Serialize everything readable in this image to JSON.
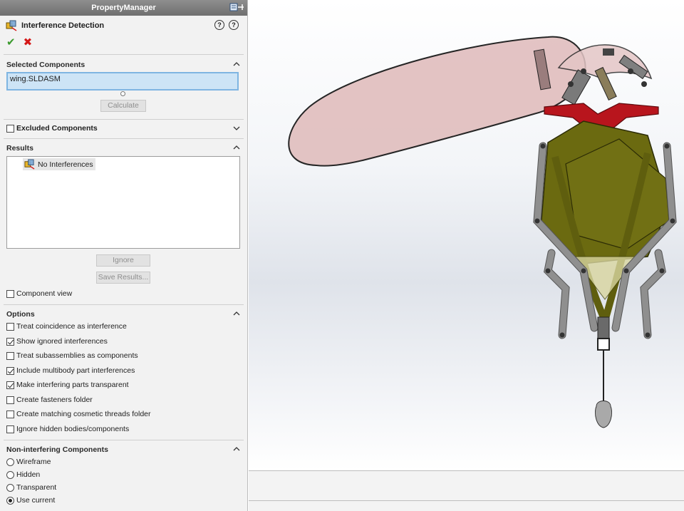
{
  "property_manager": {
    "title": "PropertyManager",
    "feature_title": "Interference Detection",
    "selected_components": {
      "label": "Selected Components",
      "value": "wing.SLDASM",
      "calculate_label": "Calculate"
    },
    "excluded_components": {
      "label": "Excluded Components",
      "checked": false
    },
    "results": {
      "label": "Results",
      "items": [
        "No Interferences"
      ],
      "ignore_label": "Ignore",
      "save_label": "Save Results...",
      "component_view_label": "Component view"
    },
    "options": {
      "label": "Options",
      "items": [
        {
          "label": "Treat coincidence as interference",
          "checked": false
        },
        {
          "label": "Show ignored interferences",
          "checked": true
        },
        {
          "label": "Treat subassemblies as components",
          "checked": false
        },
        {
          "label": "Include multibody part interferences",
          "checked": true
        },
        {
          "label": "Make interfering parts transparent",
          "checked": true
        },
        {
          "label": "Create fasteners folder",
          "checked": false
        },
        {
          "label": "Create matching cosmetic threads folder",
          "checked": false
        },
        {
          "label": "Ignore hidden bodies/components",
          "checked": false
        }
      ]
    },
    "non_interfering": {
      "label": "Non-interfering Components",
      "items": [
        {
          "label": "Wireframe",
          "selected": false
        },
        {
          "label": "Hidden",
          "selected": false
        },
        {
          "label": "Transparent",
          "selected": false
        },
        {
          "label": "Use current",
          "selected": true
        }
      ]
    }
  },
  "colors": {
    "wing_shell": "#e2c1c1",
    "olive_body": "#6b6a10",
    "grey_link": "#8f8f8f",
    "red_part": "#b8151d",
    "selection_fill": "#cde4f6",
    "selection_border": "#7fb5e2"
  },
  "icons": {
    "feature": "interference-detection-icon",
    "ok": "checkmark-icon",
    "cancel": "close-icon"
  }
}
